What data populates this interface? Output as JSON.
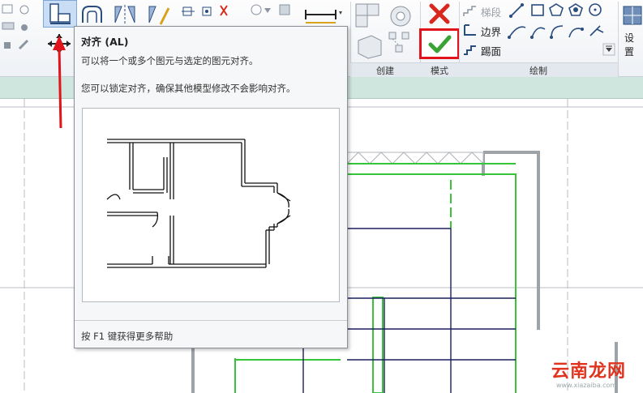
{
  "ribbon": {
    "panels": {
      "create": "创建",
      "mode": "模式",
      "draw": "绘制"
    },
    "tools": {
      "stair": "梯段",
      "boundary": "边界",
      "riser": "踢面",
      "settings": "设置"
    }
  },
  "tooltip": {
    "title": "对齐 (AL)",
    "line1": "可以将一个或多个图元与选定的图元对齐。",
    "line2": "您可以锁定对齐，确保其他模型修改不会影响对齐。",
    "help": "按 F1 键获得更多帮助"
  },
  "watermark": {
    "text": "云南龙网",
    "sub": "www.xiazaiba.com"
  },
  "colors": {
    "finish_check": "#3aa335",
    "cancel_x": "#d9281d",
    "highlight_red": "#e0141a",
    "green_outline": "#38c43a",
    "grid_navy": "#1b1f5e"
  }
}
